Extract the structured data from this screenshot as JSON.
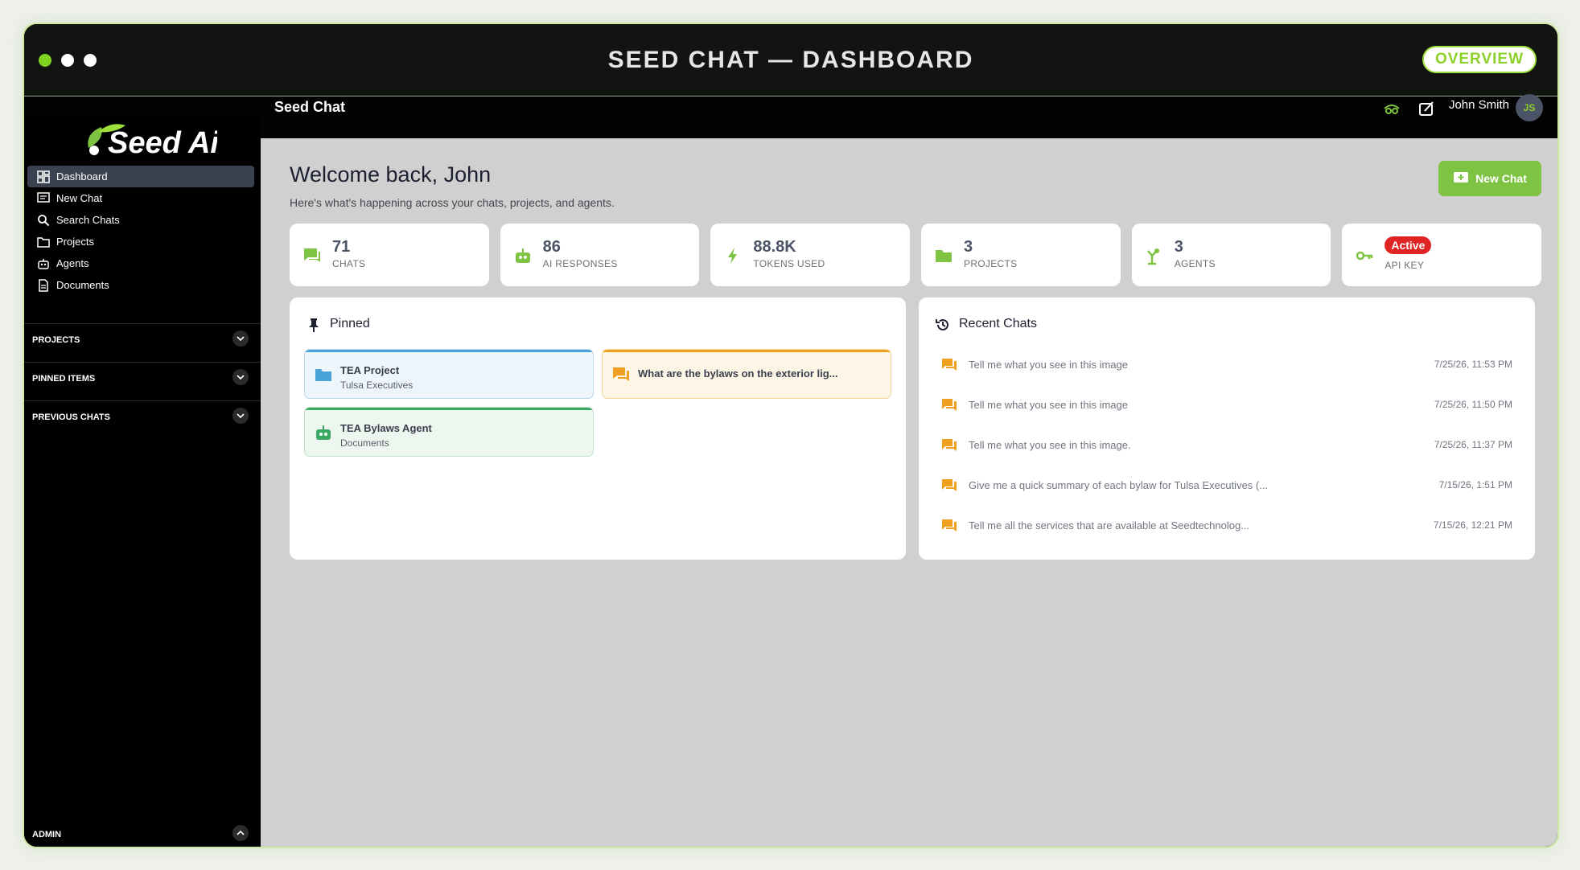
{
  "window": {
    "title": "SEED CHAT  —  DASHBOARD",
    "overview_label": "OVERVIEW"
  },
  "appbar": {
    "brand": "Seed Chat",
    "user_name": "John Smith",
    "user_initials": "JS"
  },
  "sidebar": {
    "logo_text": "Seed Ai",
    "items": [
      {
        "label": "Dashboard",
        "icon": "dashboard-icon"
      },
      {
        "label": "New Chat",
        "icon": "chat-plus-icon"
      },
      {
        "label": "Search Chats",
        "icon": "search-icon"
      },
      {
        "label": "Projects",
        "icon": "folder-icon"
      },
      {
        "label": "Agents",
        "icon": "robot-icon"
      },
      {
        "label": "Documents",
        "icon": "document-icon"
      }
    ],
    "sections": [
      "PROJECTS",
      "PINNED ITEMS",
      "PREVIOUS CHATS"
    ],
    "admin_label": "ADMIN"
  },
  "header": {
    "welcome": "Welcome back, John",
    "subtitle": "Here's what's happening across your chats, projects, and agents.",
    "new_chat_label": "New Chat"
  },
  "stats": [
    {
      "value": "71",
      "label": "CHATS",
      "icon": "chat-icon"
    },
    {
      "value": "86",
      "label": "AI RESPONSES",
      "icon": "robot-icon"
    },
    {
      "value": "88.8K",
      "label": "TOKENS USED",
      "icon": "bolt-icon"
    },
    {
      "value": "3",
      "label": "PROJECTS",
      "icon": "folder-icon"
    },
    {
      "value": "3",
      "label": "AGENTS",
      "icon": "agent-icon"
    },
    {
      "badge": "Active",
      "label": "API KEY",
      "icon": "key-icon"
    }
  ],
  "pinned": {
    "title": "Pinned",
    "items": [
      {
        "title": "TEA Project",
        "subtitle": "Tulsa Executives",
        "icon": "folder-icon"
      },
      {
        "title": "What are the bylaws on the exterior lig...",
        "icon": "chat-icon"
      },
      {
        "title": "TEA Bylaws Agent",
        "subtitle": "Documents",
        "icon": "robot-icon"
      }
    ]
  },
  "recent": {
    "title": "Recent Chats",
    "items": [
      {
        "title": "Tell me what you see in this image",
        "time": "7/25/26, 11:53 PM"
      },
      {
        "title": "Tell me what you see in this image",
        "time": "7/25/26, 11:50 PM"
      },
      {
        "title": "Tell me what you see in this image.",
        "time": "7/25/26, 11:37 PM"
      },
      {
        "title": "Give me a quick summary of each bylaw for Tulsa Executives (...",
        "time": "7/15/26, 1:51 PM"
      },
      {
        "title": "Tell me all the services that are available at Seedtechnolog...",
        "time": "7/15/26, 12:21 PM"
      }
    ]
  },
  "colors": {
    "accent": "#7fc342",
    "orange": "#f0a020",
    "blue": "#4aa3d8",
    "danger": "#e02424"
  }
}
